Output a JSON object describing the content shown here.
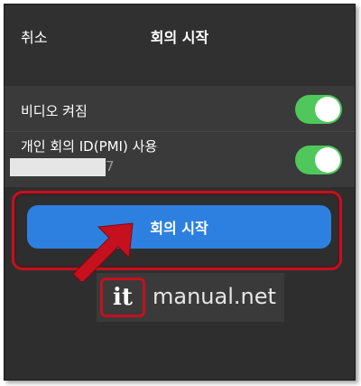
{
  "header": {
    "cancel_label": "취소",
    "title": "회의 시작"
  },
  "settings": {
    "video": {
      "label": "비디오 켜짐",
      "enabled": true
    },
    "pmi": {
      "label": "개인 회의 ID(PMI) 사용",
      "number_visible_tail": "7",
      "enabled": true
    }
  },
  "start_button": {
    "label": "회의 시작"
  },
  "watermark": {
    "logo": "it",
    "text": "manual.net"
  },
  "colors": {
    "toggle_on": "#4fc75a",
    "button": "#2d80e0",
    "highlight": "#c5101e"
  }
}
